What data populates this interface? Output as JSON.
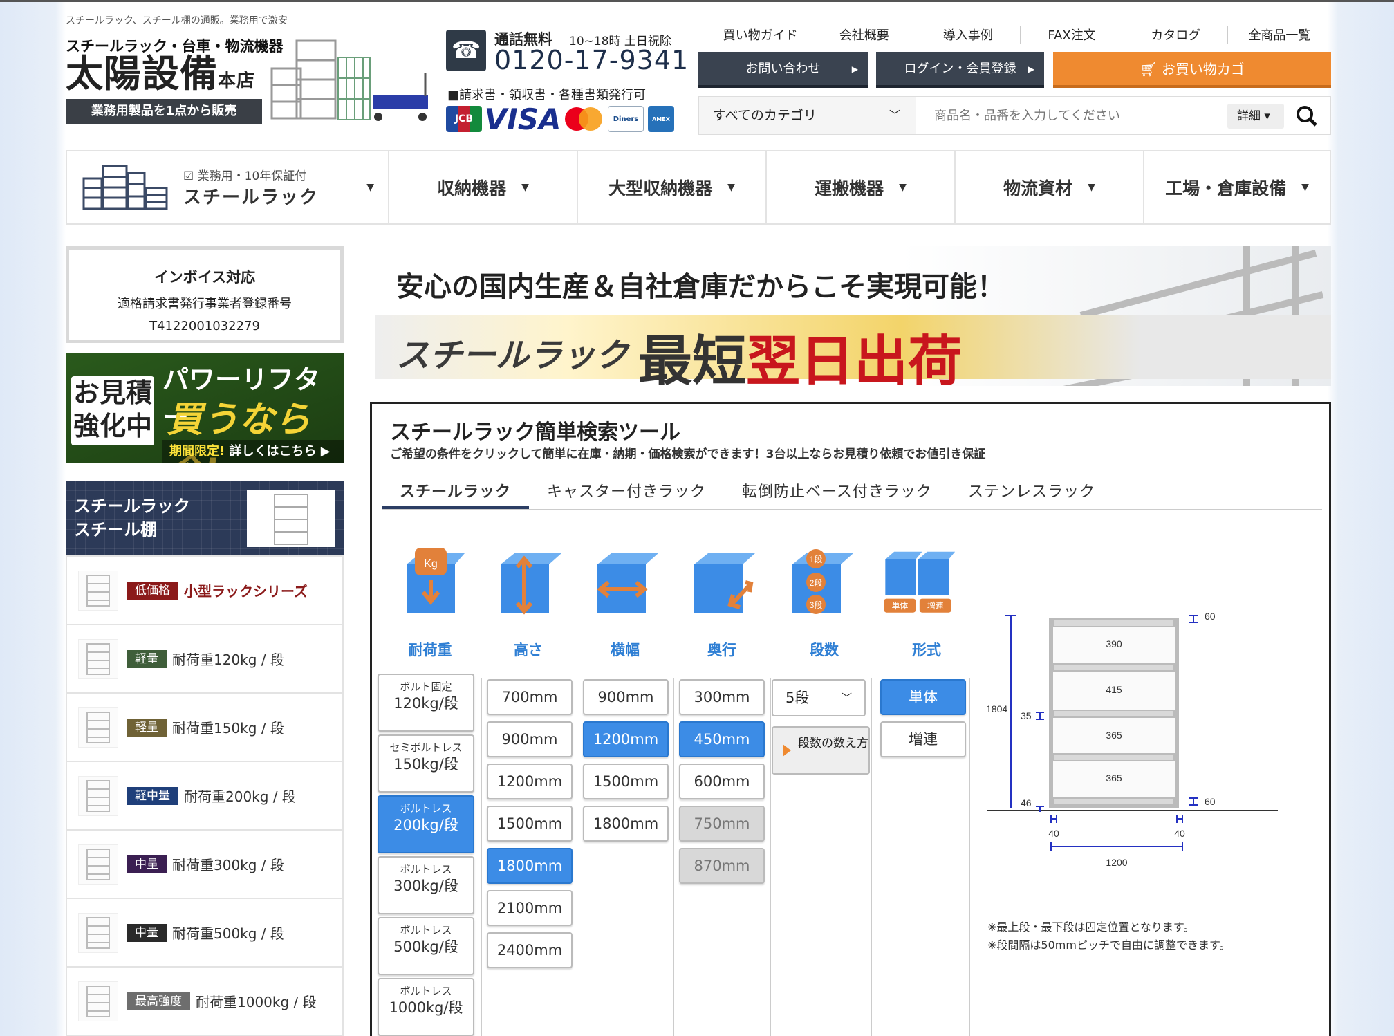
{
  "header": {
    "tagline": "スチールラック、スチール棚の通販。業務用で激安",
    "logo_sub": "スチールラック・台車・物流機器",
    "logo_main": "太陽設備",
    "logo_suffix": "本店",
    "logo_badge": "業務用製品を1点から販売",
    "free_call": "通話無料",
    "hours": "10~18時 土日祝除",
    "phone": "0120-17-9341",
    "invoice_note": "■請求書・領収書・各種書類発行可",
    "cards": [
      "JCB",
      "VISA",
      "Mastercard",
      "Diners Club International",
      "AMERICAN EXPRESS"
    ],
    "gnav": [
      "買い物ガイド",
      "会社概要",
      "導入事例",
      "FAX注文",
      "カタログ",
      "全商品一覧"
    ],
    "btn_contact": "お問い合わせ",
    "btn_login": "ログイン・会員登録",
    "btn_cart": "お買い物カゴ",
    "search_category": "すべてのカテゴリ",
    "search_placeholder": "商品名・品番を入力してください",
    "search_detail": "詳細"
  },
  "catnav": {
    "first_small": "業務用・10年保証付",
    "first_big": "スチールラック",
    "items": [
      "収納機器",
      "大型収納機器",
      "運搬機器",
      "物流資材",
      "工場・倉庫設備"
    ]
  },
  "sidebar": {
    "invoice_title": "インボイス対応",
    "invoice_sub": "適格請求書発行事業者登録番号",
    "invoice_no": "T4122001032279",
    "promo_q1": "お見積",
    "promo_q2": "強化中",
    "promo_t1": "パワーリフター",
    "promo_t2": "買うなら今!",
    "promo_t3a": "期間限定!",
    "promo_t3b": "詳しくはこちら ▶",
    "head_line1": "スチールラック",
    "head_line2": "スチール棚",
    "items": [
      {
        "badge": "低価格",
        "label": "小型ラックシリーズ",
        "color": "#8b1a1a"
      },
      {
        "badge": "軽量",
        "label": "耐荷重120kg / 段",
        "color": "#3f5e3a"
      },
      {
        "badge": "軽量",
        "label": "耐荷重150kg / 段",
        "color": "#6f6236"
      },
      {
        "badge": "軽中量",
        "label": "耐荷重200kg / 段",
        "color": "#1f3f7a"
      },
      {
        "badge": "中量",
        "label": "耐荷重300kg / 段",
        "color": "#3b1f52"
      },
      {
        "badge": "中量",
        "label": "耐荷重500kg / 段",
        "color": "#2a2a2a"
      },
      {
        "badge": "最高強度",
        "label": "耐荷重1000kg / 段",
        "color": "#6e6e6e"
      }
    ]
  },
  "banner": {
    "line1": "安心の国内生産＆自社倉庫だからこそ実現可能！",
    "line2": "スチールラック",
    "line3a": "最短",
    "line3b": "翌日出荷"
  },
  "tool": {
    "title": "スチールラック簡単検索ツール",
    "subtitle": "ご希望の条件をクリックして簡単に在庫・納期・価格検索ができます！3台以上ならお見積り依頼でお値引き保証",
    "tabs": [
      "スチールラック",
      "キャスター付きラック",
      "転倒防止ベース付きラック",
      "ステンレスラック"
    ],
    "col_labels": [
      "耐荷重",
      "高さ",
      "横幅",
      "奥行",
      "段数",
      "形式"
    ],
    "load": [
      {
        "small": "ボルト固定",
        "val": "120kg/段"
      },
      {
        "small": "セミボルトレス",
        "val": "150kg/段"
      },
      {
        "small": "ボルトレス",
        "val": "200kg/段"
      },
      {
        "small": "ボルトレス",
        "val": "300kg/段"
      },
      {
        "small": "ボルトレス",
        "val": "500kg/段"
      },
      {
        "small": "ボルトレス",
        "val": "1000kg/段"
      }
    ],
    "height": [
      "700mm",
      "900mm",
      "1200mm",
      "1500mm",
      "1800mm",
      "2100mm",
      "2400mm"
    ],
    "width": [
      "900mm",
      "1200mm",
      "1500mm",
      "1800mm"
    ],
    "depth": [
      "300mm",
      "450mm",
      "600mm",
      "750mm",
      "870mm"
    ],
    "tiers_value": "5段",
    "howto": "段数の数え方",
    "format": [
      "単体",
      "増連"
    ],
    "icon_badges": [
      "単体",
      "増連"
    ],
    "diagram": {
      "shelves": [
        "390",
        "415",
        "365",
        "365"
      ],
      "total_h": "1804",
      "top": "60",
      "bottom": "60",
      "gap35": "35",
      "gap46": "46",
      "foot_l": "40",
      "foot_r": "40",
      "width": "1200",
      "icon_kg": "Kg",
      "icon_tiers": [
        "1段",
        "2段",
        "3段"
      ]
    },
    "notes": [
      "※最上段・最下段は固定位置となります。",
      "※段間隔は50mmピッチで自由に調整できます。"
    ]
  }
}
